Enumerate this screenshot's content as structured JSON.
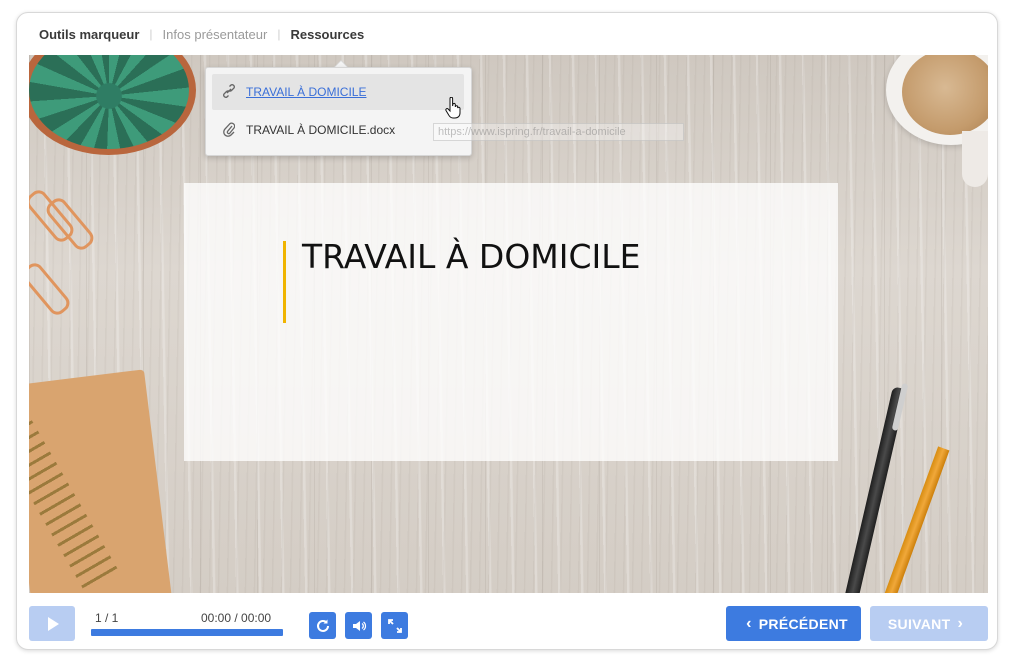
{
  "tabs": [
    {
      "label": "Outils marqueur",
      "state": "active"
    },
    {
      "label": "Infos présentateur",
      "state": "inactive"
    },
    {
      "label": "Ressources",
      "state": "active"
    }
  ],
  "resources_menu": {
    "items": [
      {
        "label": "TRAVAIL À DOMICILE",
        "icon": "link-icon",
        "type": "link"
      },
      {
        "label": "TRAVAIL À DOMICILE.docx",
        "icon": "paperclip-icon",
        "type": "file"
      }
    ],
    "tooltip": "https://www.ispring.fr/travail-a-domicile"
  },
  "slide": {
    "title": "TRAVAIL À DOMICILE",
    "accent_color": "#f0b400"
  },
  "player": {
    "play_icon": "play-icon",
    "slide_counter": "1 / 1",
    "time": "00:00 / 00:00",
    "progress": 1.0,
    "replay_icon": "replay-icon",
    "volume_icon": "volume-icon",
    "fullscreen_icon": "fullscreen-icon",
    "prev_label": "PRÉCÉDENT",
    "next_label": "SUIVANT",
    "accent_color": "#3d7be0",
    "disabled_color": "#b8cdf2"
  }
}
